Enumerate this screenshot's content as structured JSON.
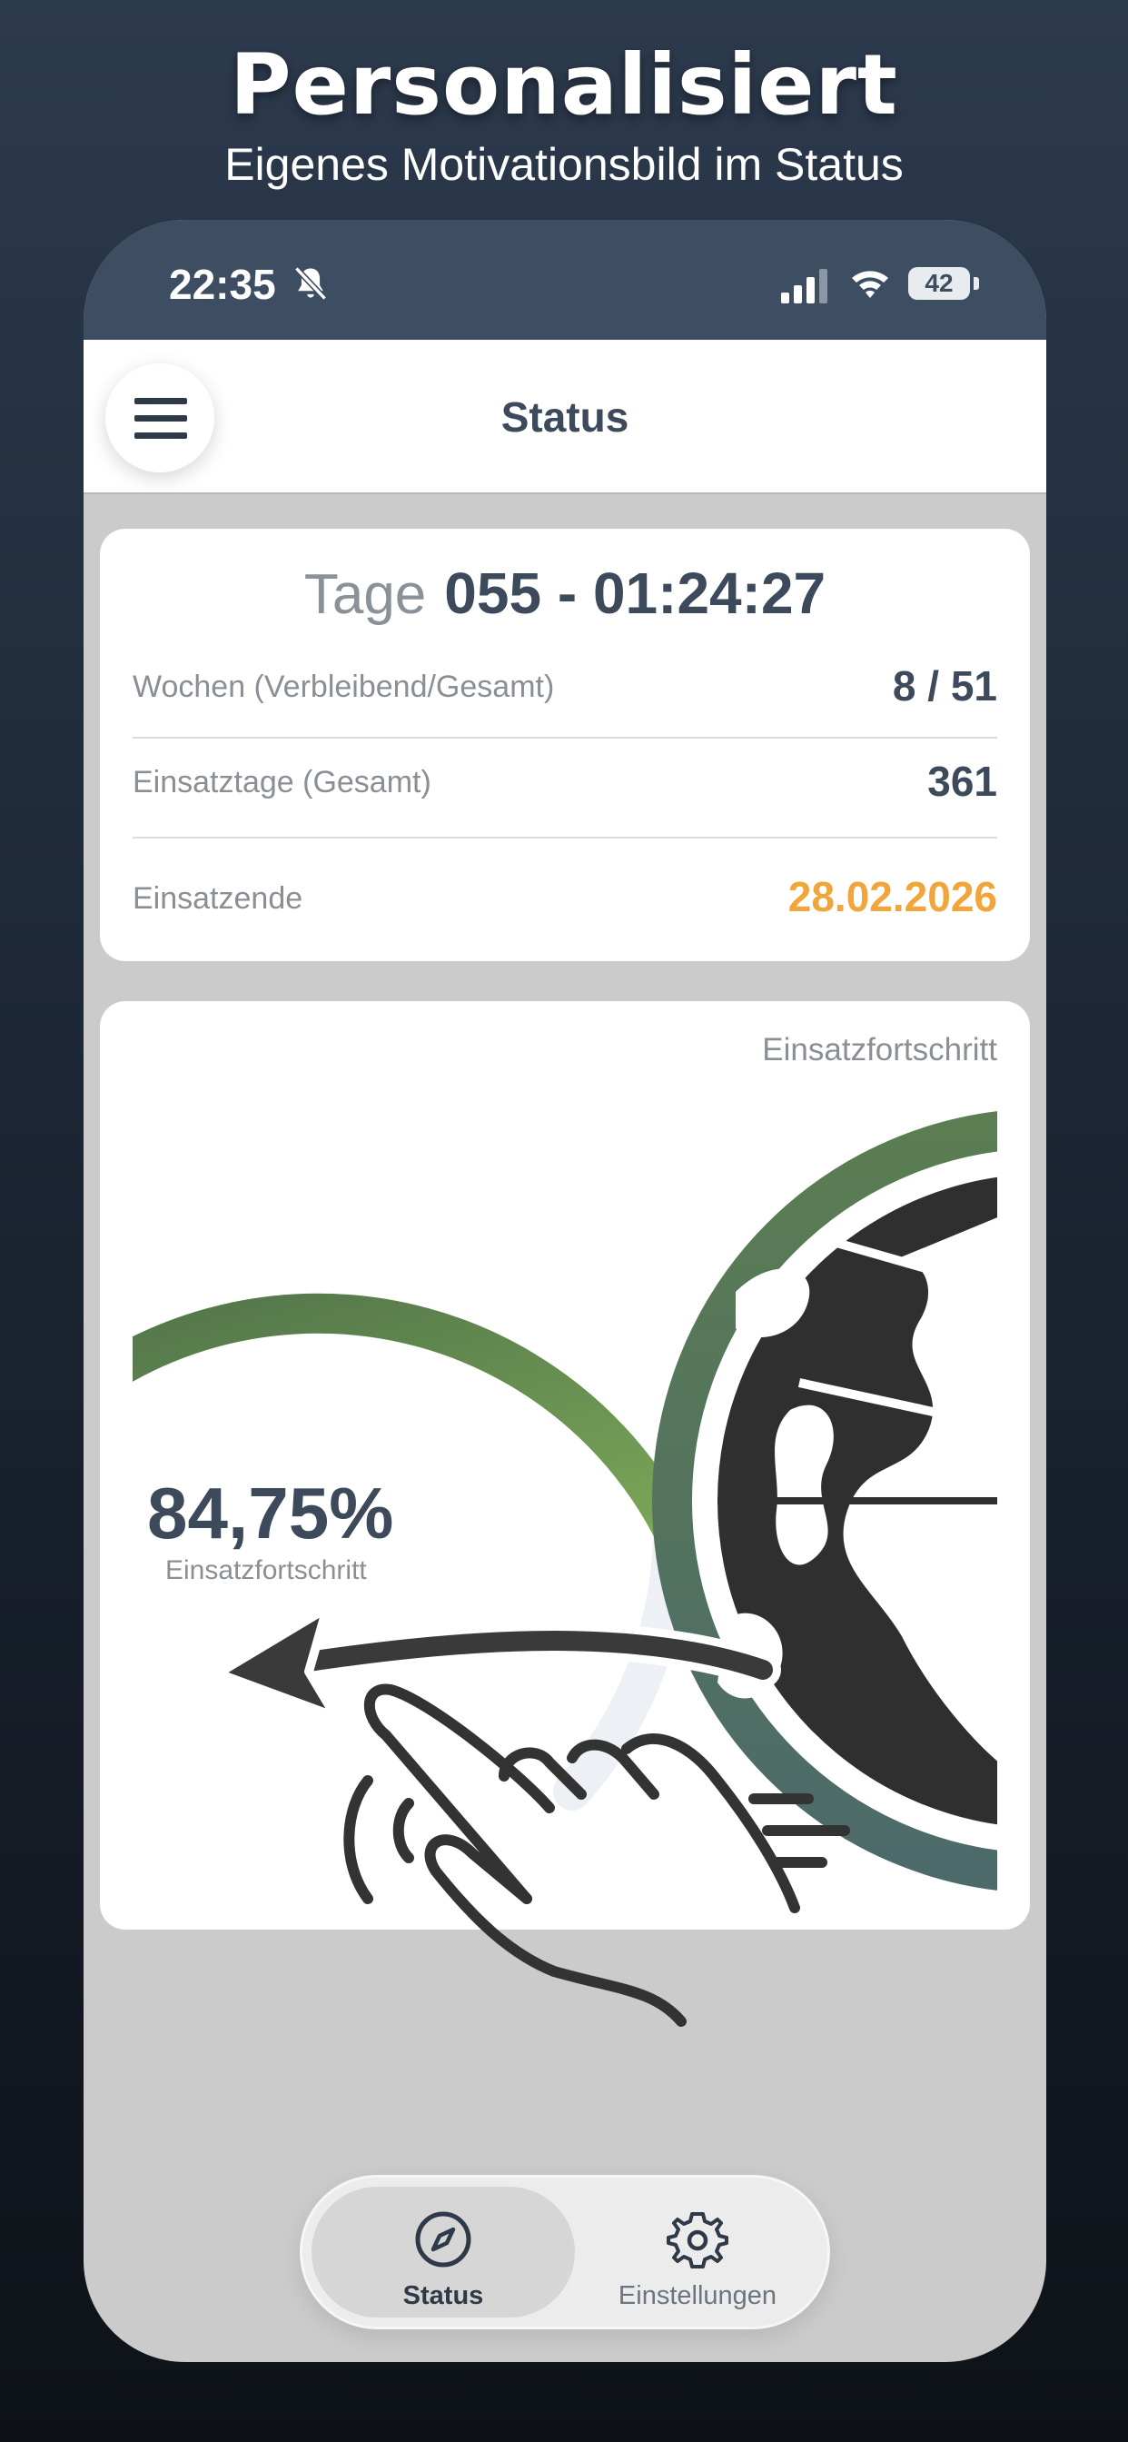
{
  "promo": {
    "title": "Personalisiert",
    "subtitle": "Eigenes Motivationsbild im Status"
  },
  "statusbar": {
    "time": "22:35",
    "battery": "42",
    "icons": [
      "bell-slash-icon",
      "cellular-signal-icon",
      "wifi-icon",
      "battery-icon"
    ]
  },
  "appbar": {
    "title": "Status",
    "menu_icon": "hamburger-menu-icon"
  },
  "summary": {
    "tage_label": "Tage",
    "tage_value": "055 - 01:24:27",
    "rows": [
      {
        "label": "Wochen (Verbleibend/Gesamt)",
        "value": "8 / 51"
      },
      {
        "label": "Einsatztage (Gesamt)",
        "value": "361"
      },
      {
        "label": "Einsatzende",
        "value": "28.02.2026"
      }
    ],
    "accent_color": "#f0a63a"
  },
  "progress": {
    "caption": "Einsatzfortschritt",
    "percent_text": "84,75%",
    "percent_label": "Einsatzfortschritt",
    "fraction": 0.8475,
    "gauge_colors": {
      "start": "#4e7049",
      "end": "#7aa657",
      "track": "#edf1f6"
    },
    "motivation_image": "globe-image"
  },
  "gesture_hint": {
    "icons": [
      "swipe-left-arrow-icon",
      "hand-swipe-icon"
    ]
  },
  "nav": {
    "items": [
      {
        "label": "Status",
        "icon": "compass-icon",
        "active": true
      },
      {
        "label": "Einstellungen",
        "icon": "gear-icon",
        "active": false
      }
    ]
  }
}
